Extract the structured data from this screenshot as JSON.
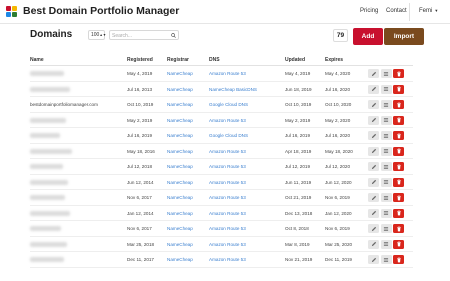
{
  "navbar": {
    "brand": "Best Domain Portfolio Manager",
    "links": [
      "Pricing",
      "Contact"
    ],
    "user": "Femi",
    "logo_colors": [
      "#c8102e",
      "#f5b700",
      "#1e88e5",
      "#2e7d32"
    ]
  },
  "toolbar": {
    "title": "Domains",
    "page_size": "100",
    "search_placeholder": "Search...",
    "count": "79",
    "add_label": "Add",
    "import_label": "Import"
  },
  "table": {
    "columns": [
      "Name",
      "Registered",
      "Registrar",
      "DNS",
      "Updated",
      "Expires"
    ],
    "rows": [
      {
        "name": "",
        "registered": "May 4, 2019",
        "registrar": "NameCheap",
        "dns": "Amazon Route 53",
        "updated": "May 4, 2019",
        "expires": "May 4, 2020"
      },
      {
        "name": "",
        "registered": "Jul 16, 2013",
        "registrar": "NameCheap",
        "dns": "NameCheap BasicDNS",
        "updated": "Jun 18, 2019",
        "expires": "Jul 16, 2020"
      },
      {
        "name": "bestdomainportfoliomanager.com",
        "registered": "Oct 10, 2019",
        "registrar": "NameCheap",
        "dns": "Google Cloud DNS",
        "updated": "Oct 10, 2019",
        "expires": "Oct 10, 2020"
      },
      {
        "name": "",
        "registered": "May 2, 2019",
        "registrar": "NameCheap",
        "dns": "Amazon Route 53",
        "updated": "May 2, 2019",
        "expires": "May 2, 2020"
      },
      {
        "name": "",
        "registered": "Jul 16, 2019",
        "registrar": "NameCheap",
        "dns": "Google Cloud DNS",
        "updated": "Jul 16, 2019",
        "expires": "Jul 16, 2020"
      },
      {
        "name": "",
        "registered": "May 18, 2016",
        "registrar": "NameCheap",
        "dns": "Amazon Route 53",
        "updated": "Apr 18, 2019",
        "expires": "May 18, 2020"
      },
      {
        "name": "",
        "registered": "Jul 12, 2018",
        "registrar": "NameCheap",
        "dns": "Amazon Route 53",
        "updated": "Jul 12, 2019",
        "expires": "Jul 12, 2020"
      },
      {
        "name": "",
        "registered": "Jun 12, 2014",
        "registrar": "NameCheap",
        "dns": "Amazon Route 53",
        "updated": "Jun 11, 2019",
        "expires": "Jun 12, 2020"
      },
      {
        "name": "",
        "registered": "Nov 6, 2017",
        "registrar": "NameCheap",
        "dns": "Amazon Route 53",
        "updated": "Oct 21, 2019",
        "expires": "Nov 6, 2019"
      },
      {
        "name": "",
        "registered": "Jan 12, 2014",
        "registrar": "NameCheap",
        "dns": "Amazon Route 53",
        "updated": "Dec 13, 2018",
        "expires": "Jan 12, 2020"
      },
      {
        "name": "",
        "registered": "Nov 6, 2017",
        "registrar": "NameCheap",
        "dns": "Amazon Route 53",
        "updated": "Oct 8, 2018",
        "expires": "Nov 6, 2019"
      },
      {
        "name": "",
        "registered": "Mar 25, 2018",
        "registrar": "NameCheap",
        "dns": "Amazon Route 53",
        "updated": "Mar 8, 2019",
        "expires": "Mar 25, 2020"
      },
      {
        "name": "",
        "registered": "Dec 11, 2017",
        "registrar": "NameCheap",
        "dns": "Amazon Route 53",
        "updated": "Nov 21, 2019",
        "expires": "Dec 11, 2019"
      }
    ]
  },
  "icons": {
    "edit": "pencil-icon",
    "list": "list-icon",
    "delete": "trash-icon",
    "search": "search-icon"
  },
  "colors": {
    "add_button": "#c8102e",
    "import_button": "#7a4a1e",
    "delete_button": "#d9261c",
    "link": "#3a7fcf"
  }
}
